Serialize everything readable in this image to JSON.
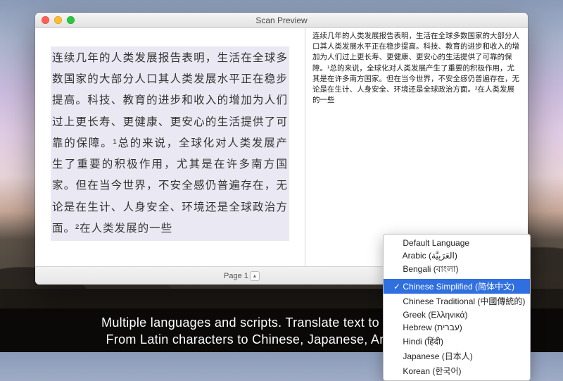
{
  "window": {
    "title": "Scan Preview"
  },
  "scanned_text": "连续几年的人类发展报告表明，生活在全球多数国家的大部分人口其人类发展水平正在稳步提高。科技、教育的进步和收入的增加为人们过上更长寿、更健康、更安心的生活提供了可靠的保障。¹总的来说，全球化对人类发展产生了重要的积极作用，尤其是在许多南方国家。但在当今世界，不安全感仍普遍存在，无论是在生计、人身安全、环境还是全球政治方面。²在人类发展的一些",
  "ocr_text": "连续几年的人类发展报告表明，生活在全球多数国家的大部分人口其人类发展水平正在稳步提高。科技、教育的进步和收入的增加为人们过上更长寿、更健康、更安心的生活提供了可靠的保障。¹总的来说，全球化对人类发展产生了重要的积极作用，尤其是在许多南方国家。但在当今世界，不安全感仍普遍存在，无论是在生计、人身安全、环境还是全球政治方面。²在人类发展的一些",
  "footer": {
    "page_label": "Page 1"
  },
  "language_menu": {
    "items": [
      "Default Language",
      "Arabic (العَرَبِيَّة)",
      "Bengali (বাংলা)",
      "Chinese Simplified (简体中文)",
      "Chinese Traditional (中國傳統的)",
      "Greek (Ελληνικά)",
      "Hebrew (עברית)",
      "Hindi (हिंदी)",
      "Japanese (日本人)",
      "Korean (한국어)"
    ],
    "selected_index": 3
  },
  "caption": {
    "line1": "Multiple languages and scripts. Translate text to any language",
    "line2": "From Latin characters to Chinese, Japanese, Arabic or Hindi"
  }
}
